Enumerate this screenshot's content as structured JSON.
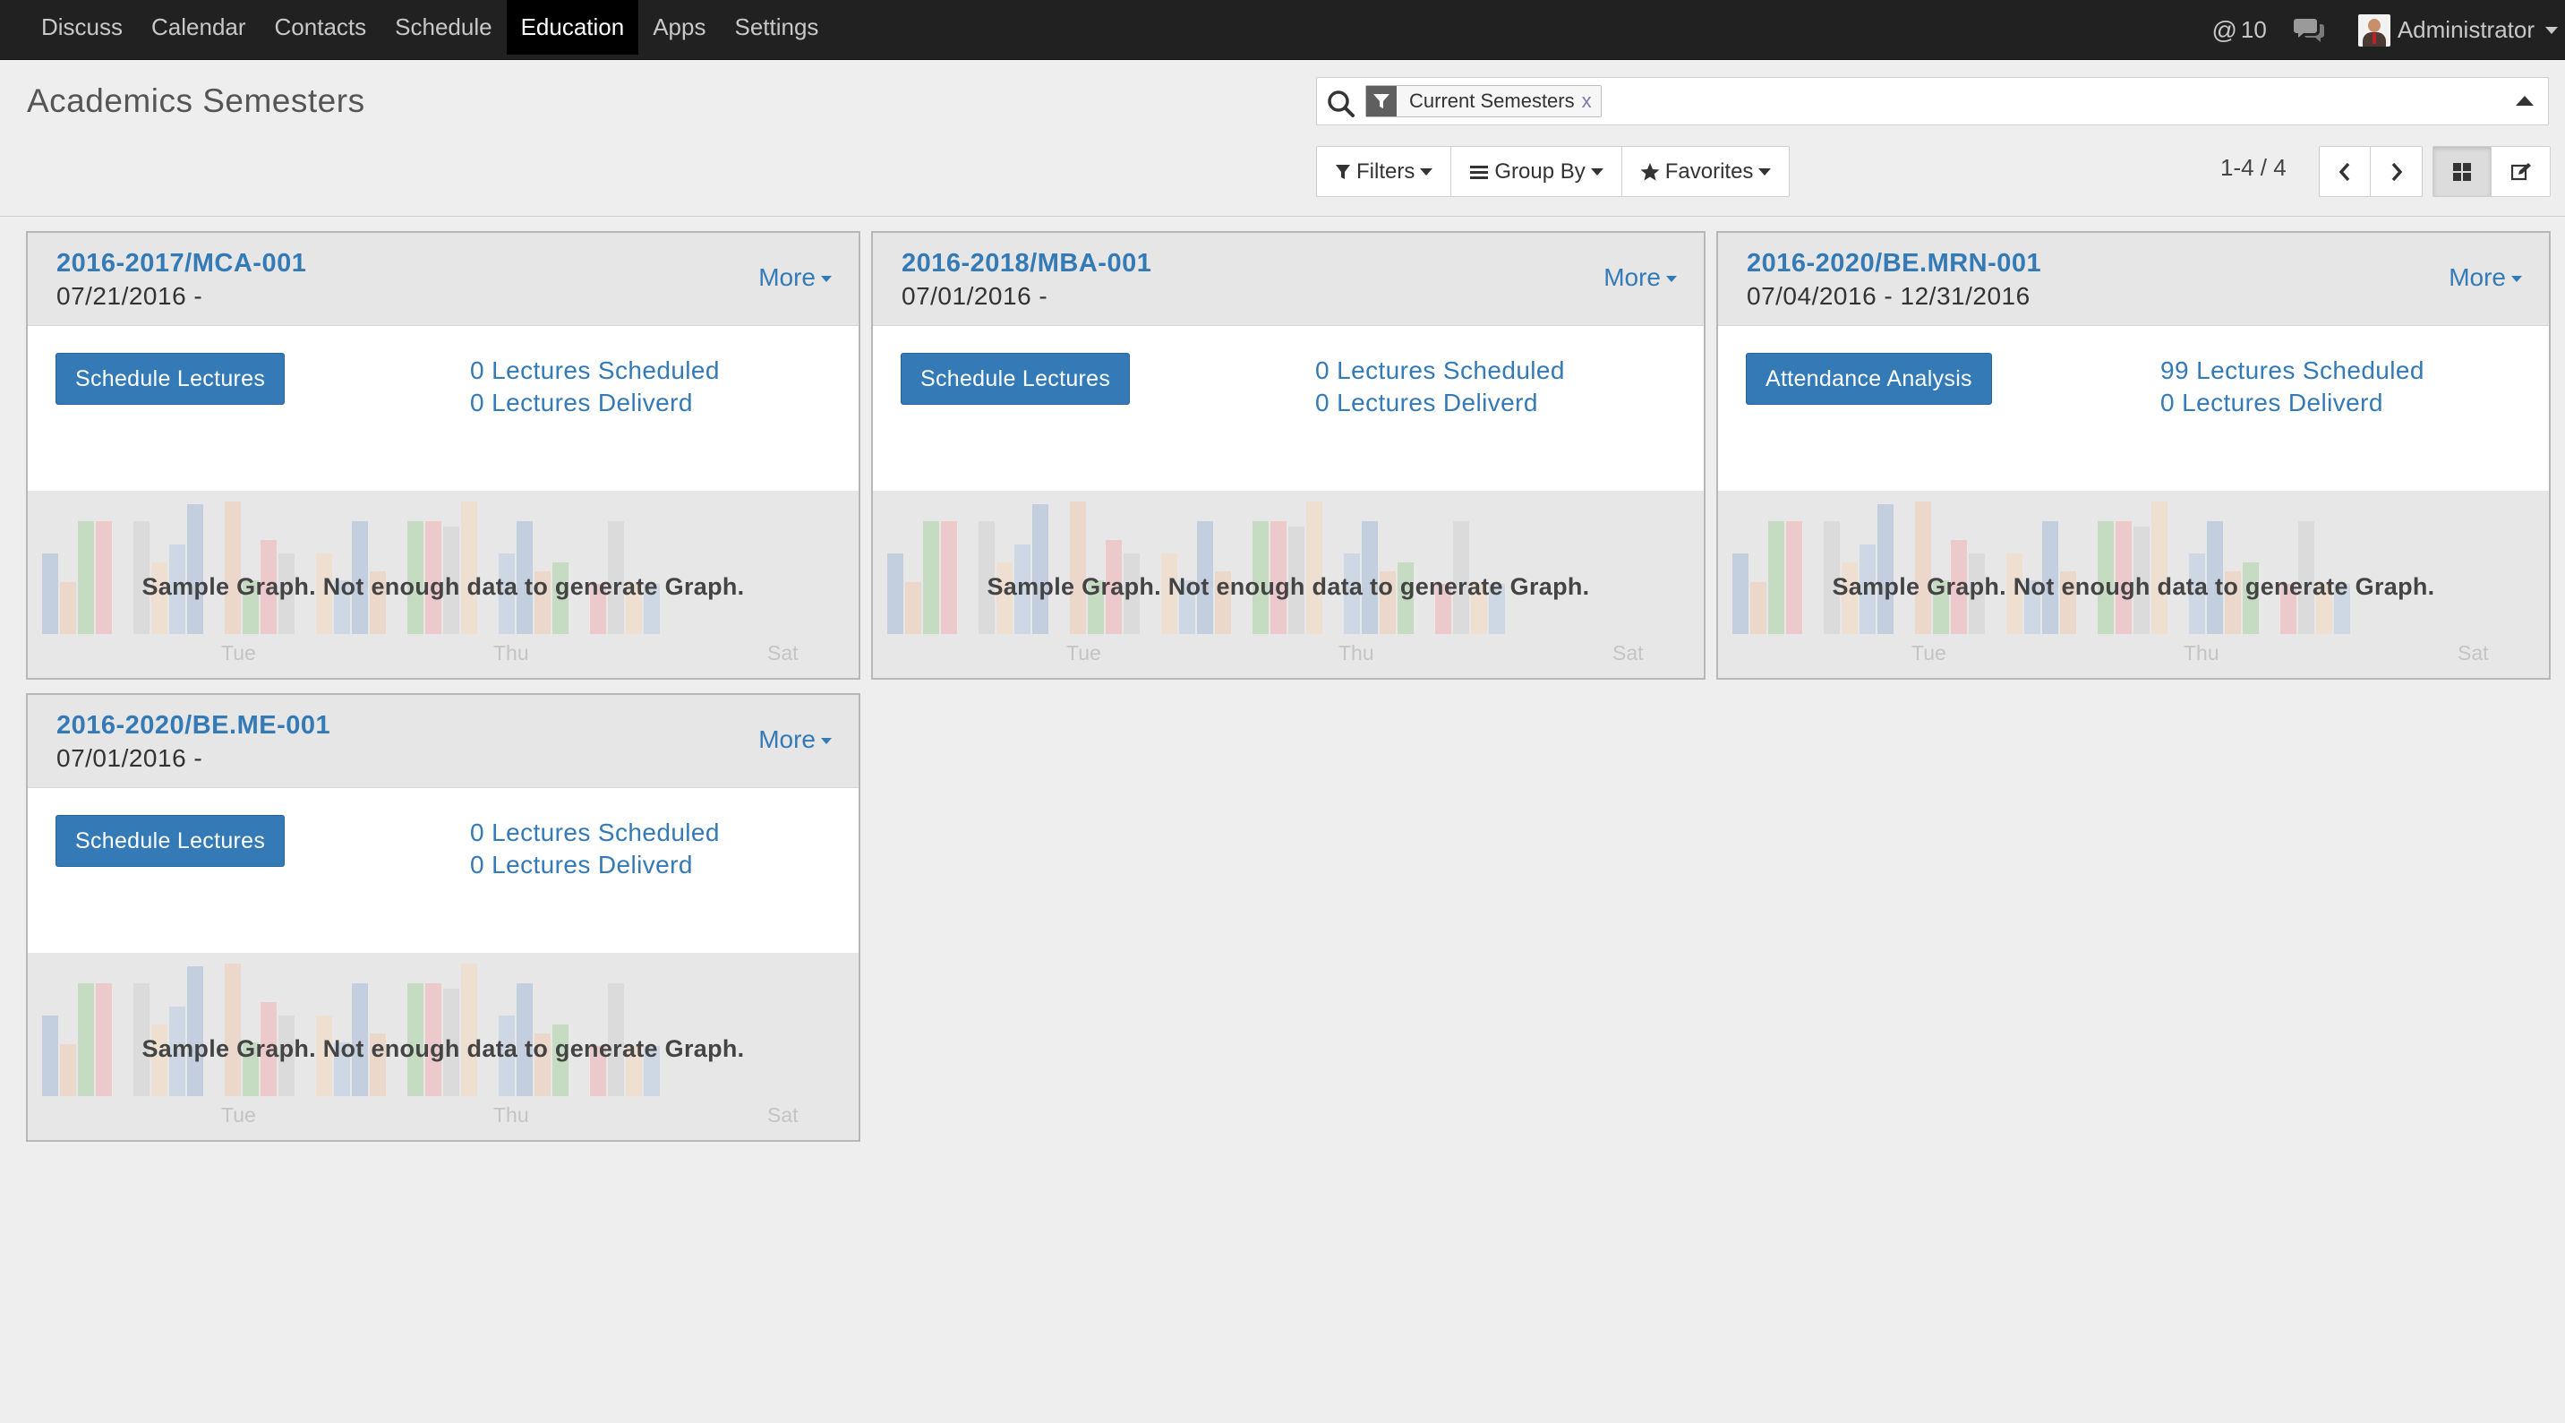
{
  "nav": {
    "items": [
      "Discuss",
      "Calendar",
      "Contacts",
      "Schedule",
      "Education",
      "Apps",
      "Settings"
    ],
    "active": "Education"
  },
  "systray": {
    "mentions_count": "10",
    "user_name": "Administrator"
  },
  "control_panel": {
    "title": "Academics Semesters",
    "search": {
      "facet_label": "Current Semesters",
      "facet_close": "x",
      "placeholder": ""
    },
    "filters_label": "Filters",
    "group_by_label": "Group By",
    "favorites_label": "Favorites",
    "pager": "1-4 / 4"
  },
  "colors": {
    "accent": "#337ab7",
    "topbar": "#212121",
    "background": "#efeeee"
  },
  "cards": [
    {
      "name": "2016-2017/MCA-001",
      "dates": "07/21/2016 -",
      "more": "More",
      "action": "Schedule Lectures",
      "stat1": "0 Lectures Scheduled",
      "stat2": "0 Lectures Deliverd",
      "graph_message": "Sample Graph. Not enough data to generate Graph.",
      "ticks": [
        "Tue",
        "Thu",
        "Sat"
      ]
    },
    {
      "name": "2016-2018/MBA-001",
      "dates": "07/01/2016 -",
      "more": "More",
      "action": "Schedule Lectures",
      "stat1": "0 Lectures Scheduled",
      "stat2": "0 Lectures Deliverd",
      "graph_message": "Sample Graph. Not enough data to generate Graph.",
      "ticks": [
        "Tue",
        "Thu",
        "Sat"
      ]
    },
    {
      "name": "2016-2020/BE.MRN-001",
      "dates": "07/04/2016 - 12/31/2016",
      "more": "More",
      "action": "Attendance Analysis",
      "stat1": "99 Lectures Scheduled",
      "stat2": "0 Lectures Deliverd",
      "graph_message": "Sample Graph. Not enough data to generate Graph.",
      "ticks": [
        "Tue",
        "Thu",
        "Sat"
      ]
    },
    {
      "name": "2016-2020/BE.ME-001",
      "dates": "07/01/2016 -",
      "more": "More",
      "action": "Schedule Lectures",
      "stat1": "0 Lectures Scheduled",
      "stat2": "0 Lectures Deliverd",
      "graph_message": "Sample Graph. Not enough data to generate Graph.",
      "ticks": [
        "Tue",
        "Thu",
        "Sat"
      ]
    }
  ]
}
